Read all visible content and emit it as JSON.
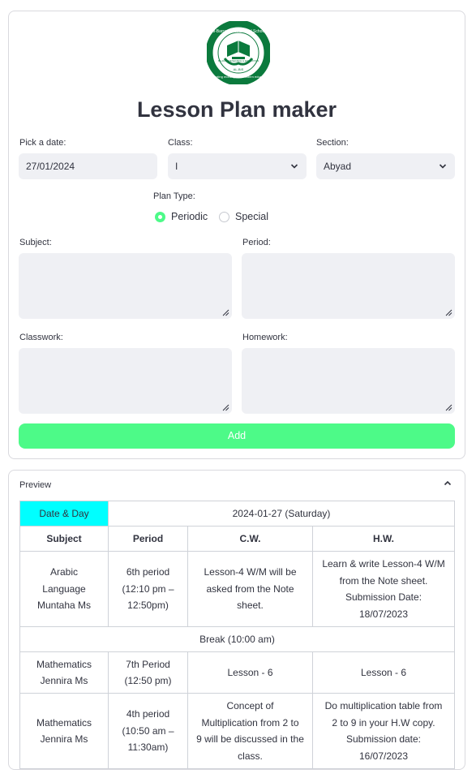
{
  "logo": {
    "arc_top": "Al-Barraq International School",
    "arc_bottom": "Promoting morality with modern education",
    "center": "ISLAMIC RESEARCH & EDUCATION",
    "est": "AL-BIS",
    "color": "#0b7a3d"
  },
  "title": "Lesson Plan maker",
  "form": {
    "date_label": "Pick a date:",
    "date_value": "27/01/2024",
    "class_label": "Class:",
    "class_value": "I",
    "section_label": "Section:",
    "section_value": "Abyad",
    "plan_type_label": "Plan Type:",
    "plan_type_options": [
      "Periodic",
      "Special"
    ],
    "plan_type_selected": "Periodic",
    "subject_label": "Subject:",
    "period_label": "Period:",
    "classwork_label": "Classwork:",
    "homework_label": "Homework:",
    "add_label": "Add"
  },
  "colors": {
    "accent": "#4dfa88",
    "field_bg": "#eff0f4",
    "highlight": "#00ffff"
  },
  "preview": {
    "label": "Preview",
    "date_day_label": "Date & Day",
    "date_day_value": "2024-01-27 (Saturday)",
    "columns": [
      "Subject",
      "Period",
      "C.W.",
      "H.W."
    ],
    "rows": [
      {
        "subject": [
          "Arabic",
          "Language",
          "Muntaha Ms"
        ],
        "period": [
          "6th period",
          "(12:10 pm –",
          "12:50pm)"
        ],
        "cw": [
          "Lesson-4 W/M will be",
          "asked from the Note",
          "sheet."
        ],
        "hw": [
          "Learn & write Lesson-4 W/M",
          "from the Note sheet.",
          "Submission Date:",
          "18/07/2023"
        ]
      },
      {
        "subject": [
          "Mathematics",
          "Jennira Ms"
        ],
        "period": [
          "7th Period",
          "(12:50 pm)"
        ],
        "cw": [
          "Lesson - 6"
        ],
        "hw": [
          "Lesson - 6"
        ]
      },
      {
        "subject": [
          "Mathematics",
          "Jennira Ms"
        ],
        "period": [
          "4th period",
          "(10:50 am –",
          "11:30am)"
        ],
        "cw": [
          "Concept of",
          "Multiplication from 2 to",
          "9 will be discussed in the",
          "class."
        ],
        "hw": [
          "Do multiplication table from",
          "2 to 9 in your H.W copy.",
          "Submission date:",
          "16/07/2023"
        ]
      }
    ],
    "break_text": "Break (10:00 am)"
  }
}
